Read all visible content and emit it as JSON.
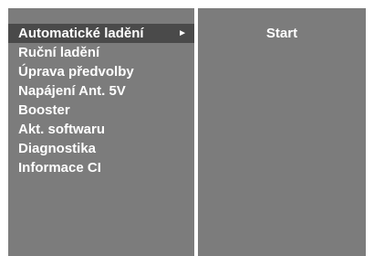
{
  "menu": {
    "items": [
      {
        "label": "Automatické ladění",
        "selected": true
      },
      {
        "label": "Ruční ladění"
      },
      {
        "label": "Úprava předvolby"
      },
      {
        "label": "Napájení Ant. 5V"
      },
      {
        "label": "Booster"
      },
      {
        "label": "Akt. softwaru"
      },
      {
        "label": "Diagnostika"
      },
      {
        "label": "Informace CI"
      }
    ],
    "arrow_icon": "triangle-right-icon"
  },
  "submenu": {
    "option": "Start"
  },
  "colors": {
    "panel": "#7c7c7c",
    "selected": "#4a4a4a",
    "text": "#ffffff",
    "background": "#ffffff"
  }
}
